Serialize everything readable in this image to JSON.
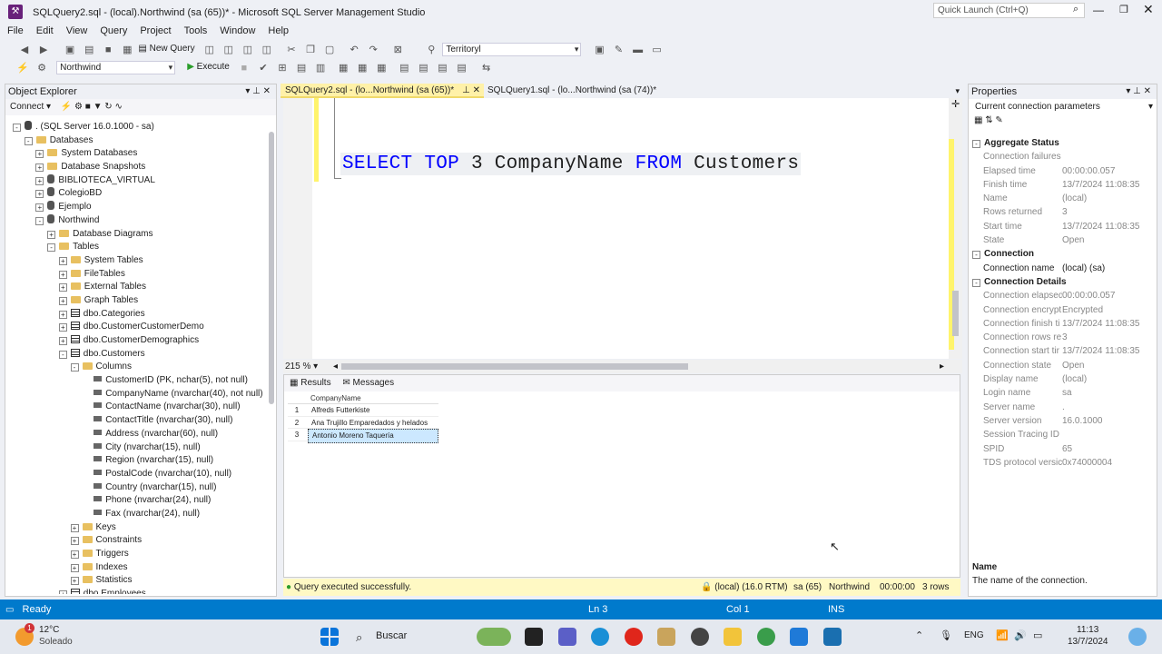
{
  "window": {
    "title": "SQLQuery2.sql - (local).Northwind (sa (65))* - Microsoft SQL Server Management Studio",
    "quick_launch": "Quick Launch (Ctrl+Q)"
  },
  "menu": [
    "File",
    "Edit",
    "View",
    "Query",
    "Project",
    "Tools",
    "Window",
    "Help"
  ],
  "toolbar": {
    "new_query": "New Query",
    "territory": "Territoryl",
    "database": "Northwind",
    "execute": "Execute"
  },
  "object_explorer": {
    "title": "Object Explorer",
    "connect": "Connect",
    "nodes": [
      {
        "label": ". (SQL Server 16.0.1000 - sa)",
        "icon": "server",
        "level": 0,
        "exp": "-"
      },
      {
        "label": "Databases",
        "icon": "folder",
        "level": 1,
        "exp": "-"
      },
      {
        "label": "System Databases",
        "icon": "folder",
        "level": 2,
        "exp": "+"
      },
      {
        "label": "Database Snapshots",
        "icon": "folder",
        "level": 2,
        "exp": "+"
      },
      {
        "label": "BIBLIOTECA_VIRTUAL",
        "icon": "db",
        "level": 2,
        "exp": "+"
      },
      {
        "label": "ColegioBD",
        "icon": "db",
        "level": 2,
        "exp": "+"
      },
      {
        "label": "Ejemplo",
        "icon": "db",
        "level": 2,
        "exp": "+"
      },
      {
        "label": "Northwind",
        "icon": "db",
        "level": 2,
        "exp": "-"
      },
      {
        "label": "Database Diagrams",
        "icon": "folder",
        "level": 3,
        "exp": "+"
      },
      {
        "label": "Tables",
        "icon": "folder",
        "level": 3,
        "exp": "-"
      },
      {
        "label": "System Tables",
        "icon": "folder",
        "level": 4,
        "exp": "+"
      },
      {
        "label": "FileTables",
        "icon": "folder",
        "level": 4,
        "exp": "+"
      },
      {
        "label": "External Tables",
        "icon": "folder",
        "level": 4,
        "exp": "+"
      },
      {
        "label": "Graph Tables",
        "icon": "folder",
        "level": 4,
        "exp": "+"
      },
      {
        "label": "dbo.Categories",
        "icon": "table",
        "level": 4,
        "exp": "+"
      },
      {
        "label": "dbo.CustomerCustomerDemo",
        "icon": "table",
        "level": 4,
        "exp": "+"
      },
      {
        "label": "dbo.CustomerDemographics",
        "icon": "table",
        "level": 4,
        "exp": "+"
      },
      {
        "label": "dbo.Customers",
        "icon": "table",
        "level": 4,
        "exp": "-"
      },
      {
        "label": "Columns",
        "icon": "folder",
        "level": 5,
        "exp": "-"
      },
      {
        "label": "CustomerID (PK, nchar(5), not null)",
        "icon": "key",
        "level": 6,
        "exp": ""
      },
      {
        "label": "CompanyName (nvarchar(40), not null)",
        "icon": "column",
        "level": 6,
        "exp": ""
      },
      {
        "label": "ContactName (nvarchar(30), null)",
        "icon": "column",
        "level": 6,
        "exp": ""
      },
      {
        "label": "ContactTitle (nvarchar(30), null)",
        "icon": "column",
        "level": 6,
        "exp": ""
      },
      {
        "label": "Address (nvarchar(60), null)",
        "icon": "column",
        "level": 6,
        "exp": ""
      },
      {
        "label": "City (nvarchar(15), null)",
        "icon": "column",
        "level": 6,
        "exp": ""
      },
      {
        "label": "Region (nvarchar(15), null)",
        "icon": "column",
        "level": 6,
        "exp": ""
      },
      {
        "label": "PostalCode (nvarchar(10), null)",
        "icon": "column",
        "level": 6,
        "exp": ""
      },
      {
        "label": "Country (nvarchar(15), null)",
        "icon": "column",
        "level": 6,
        "exp": ""
      },
      {
        "label": "Phone (nvarchar(24), null)",
        "icon": "column",
        "level": 6,
        "exp": ""
      },
      {
        "label": "Fax (nvarchar(24), null)",
        "icon": "column",
        "level": 6,
        "exp": ""
      },
      {
        "label": "Keys",
        "icon": "folder",
        "level": 5,
        "exp": "+"
      },
      {
        "label": "Constraints",
        "icon": "folder",
        "level": 5,
        "exp": "+"
      },
      {
        "label": "Triggers",
        "icon": "folder",
        "level": 5,
        "exp": "+"
      },
      {
        "label": "Indexes",
        "icon": "folder",
        "level": 5,
        "exp": "+"
      },
      {
        "label": "Statistics",
        "icon": "folder",
        "level": 5,
        "exp": "+"
      },
      {
        "label": "dbo.Employees",
        "icon": "table",
        "level": 4,
        "exp": "+"
      }
    ]
  },
  "tabs": [
    {
      "label": "SQLQuery2.sql - (lo...Northwind (sa (65))*",
      "active": true
    },
    {
      "label": "SQLQuery1.sql - (lo...Northwind (sa (74))*",
      "active": false
    }
  ],
  "editor": {
    "kw_select": "SELECT",
    "kw_top": "TOP",
    "num": "3",
    "col": "CompanyName",
    "kw_from": "FROM",
    "table": "Customers",
    "zoom": "215 %"
  },
  "results": {
    "tab_results": "Results",
    "tab_messages": "Messages",
    "header": "CompanyName",
    "rows": [
      {
        "n": "1",
        "v": "Alfreds Futterkiste"
      },
      {
        "n": "2",
        "v": "Ana Trujillo Emparedados y helados"
      },
      {
        "n": "3",
        "v": "Antonio Moreno Taquería"
      }
    ]
  },
  "query_status": {
    "message": "Query executed successfully.",
    "server": "(local) (16.0 RTM)",
    "user": "sa (65)",
    "db": "Northwind",
    "time": "00:00:00",
    "rows": "3 rows"
  },
  "properties": {
    "title": "Properties",
    "selector": "Current connection parameters",
    "items": [
      {
        "type": "section",
        "k": "Aggregate Status"
      },
      {
        "k": "Connection failures",
        "v": ""
      },
      {
        "k": "Elapsed time",
        "v": "00:00:00.057"
      },
      {
        "k": "Finish time",
        "v": "13/7/2024 11:08:35"
      },
      {
        "k": "Name",
        "v": "(local)"
      },
      {
        "k": "Rows returned",
        "v": "3"
      },
      {
        "k": "Start time",
        "v": "13/7/2024 11:08:35"
      },
      {
        "k": "State",
        "v": "Open"
      },
      {
        "type": "section",
        "k": "Connection"
      },
      {
        "k": "Connection name",
        "v": "(local) (sa)",
        "dark": true
      },
      {
        "type": "section",
        "k": "Connection Details"
      },
      {
        "k": "Connection elapsed",
        "v": "00:00:00.057"
      },
      {
        "k": "Connection encrypt",
        "v": "Encrypted"
      },
      {
        "k": "Connection finish ti",
        "v": "13/7/2024 11:08:35"
      },
      {
        "k": "Connection rows re",
        "v": "3"
      },
      {
        "k": "Connection start tir",
        "v": "13/7/2024 11:08:35"
      },
      {
        "k": "Connection state",
        "v": "Open"
      },
      {
        "k": "Display name",
        "v": "(local)"
      },
      {
        "k": "Login name",
        "v": "sa"
      },
      {
        "k": "Server name",
        "v": "."
      },
      {
        "k": "Server version",
        "v": "16.0.1000"
      },
      {
        "k": "Session Tracing ID",
        "v": ""
      },
      {
        "k": "SPID",
        "v": "65"
      },
      {
        "k": "TDS protocol versic",
        "v": "0x74000004"
      }
    ],
    "desc_title": "Name",
    "desc_text": "The name of the connection."
  },
  "statusbar": {
    "ready": "Ready",
    "ln": "Ln 3",
    "col": "Col 1",
    "ins": "INS"
  },
  "taskbar": {
    "temp": "12°C",
    "weather": "Soleado",
    "search": "Buscar",
    "lang": "ENG",
    "time": "11:13",
    "date": "13/7/2024",
    "badge": "1"
  },
  "colors": {
    "accent": "#007acc",
    "selection": "#cce8ff",
    "keyword": "#0000ff"
  }
}
